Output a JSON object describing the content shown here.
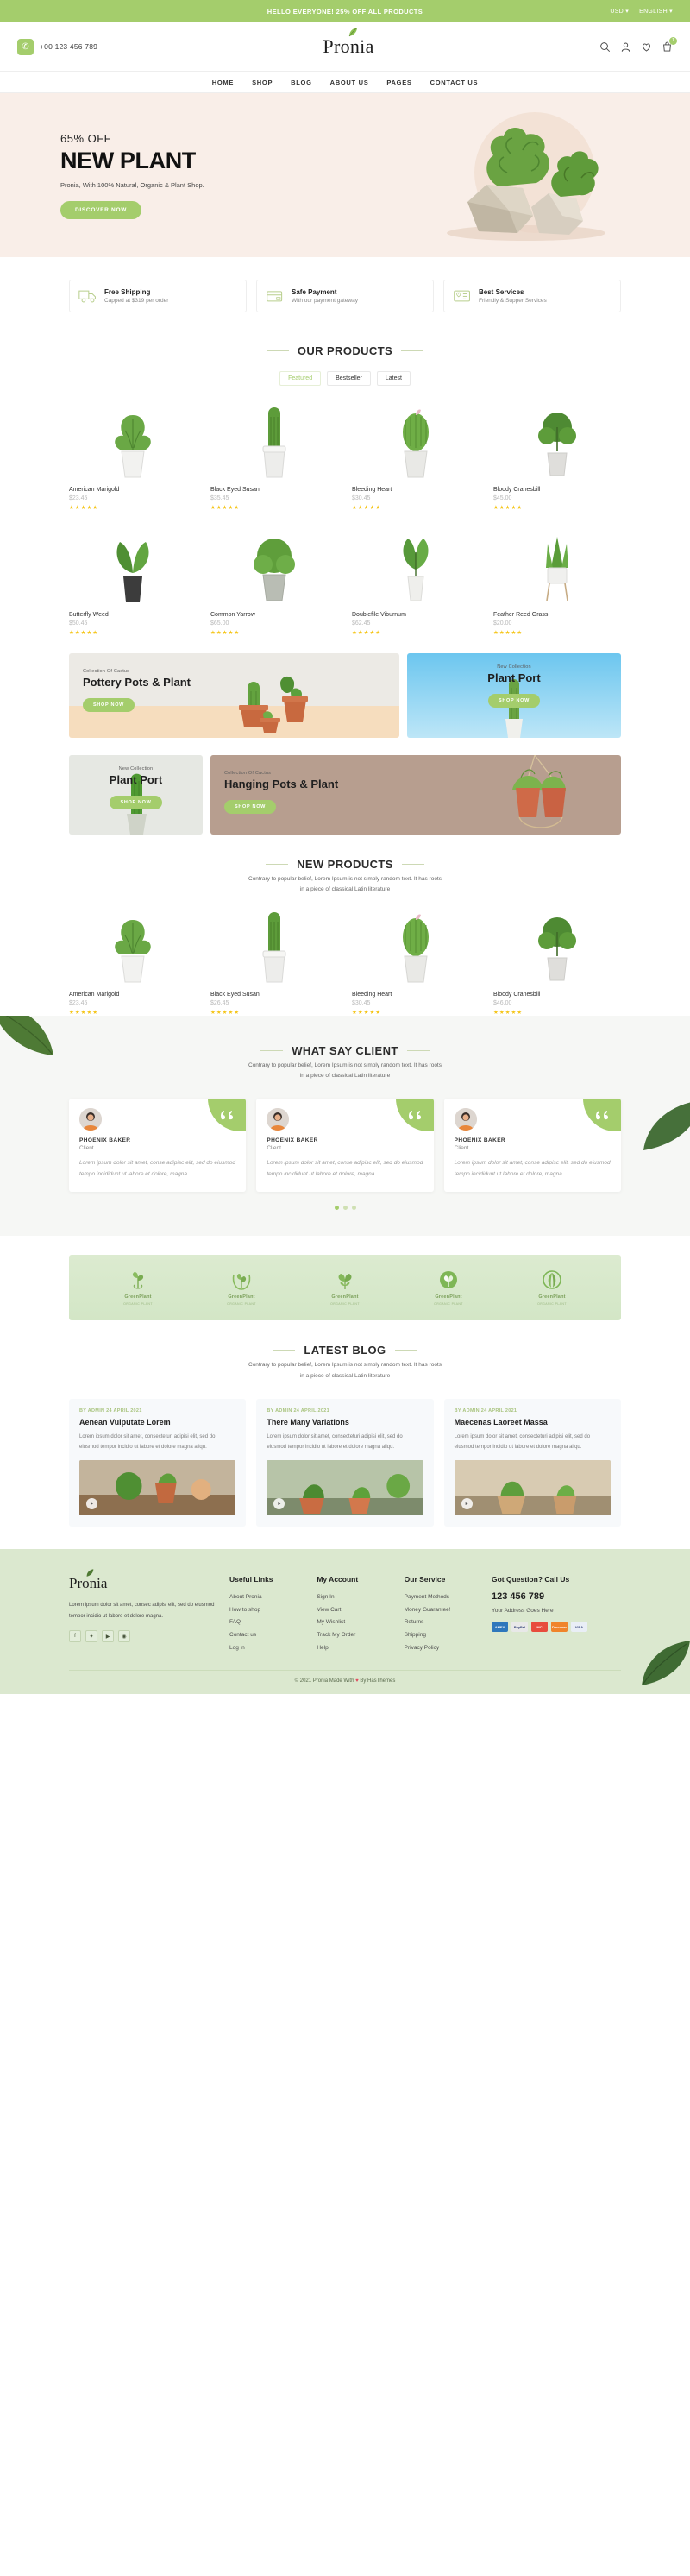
{
  "topbar": {
    "promo": "HELLO EVERYONE! 25% OFF ALL PRODUCTS",
    "currency": "USD",
    "language": "ENGLISH"
  },
  "header": {
    "phone": "+00 123 456 789",
    "logo": "Pronia",
    "icons": [
      "search-icon",
      "user-icon",
      "wishlist-icon",
      "cart-icon"
    ],
    "cart_count": "1"
  },
  "nav": {
    "items": [
      "HOME",
      "SHOP",
      "BLOG",
      "ABOUT US",
      "PAGES",
      "CONTACT US"
    ]
  },
  "hero": {
    "offer": "65% OFF",
    "title": "NEW PLANT",
    "subtitle": "Pronia, With 100% Natural, Organic & Plant Shop.",
    "cta": "DISCOVER NOW"
  },
  "features": [
    {
      "icon": "truck-icon",
      "title": "Free Shipping",
      "subtitle": "Capped at $319 per order"
    },
    {
      "icon": "card-icon",
      "title": "Safe Payment",
      "subtitle": "With our payment gateway"
    },
    {
      "icon": "support-icon",
      "title": "Best Services",
      "subtitle": "Friendly & Supper Services"
    }
  ],
  "products_section": {
    "title": "OUR PRODUCTS",
    "tabs": [
      {
        "label": "Featured",
        "active": true
      },
      {
        "label": "Bestseller",
        "active": false
      },
      {
        "label": "Latest",
        "active": false
      }
    ],
    "items": [
      {
        "name": "American Marigold",
        "price": "$23.45",
        "rating": 5
      },
      {
        "name": "Black Eyed Susan",
        "price": "$35.45",
        "rating": 5
      },
      {
        "name": "Bleeding Heart",
        "price": "$30.45",
        "rating": 5
      },
      {
        "name": "Bloody Cranesbill",
        "price": "$45.00",
        "rating": 5
      },
      {
        "name": "Butterfly Weed",
        "price": "$50.45",
        "rating": 5
      },
      {
        "name": "Common Yarrow",
        "price": "$65.00",
        "rating": 5
      },
      {
        "name": "Doublefile Viburnum",
        "price": "$62.45",
        "rating": 5
      },
      {
        "name": "Feather Reed Grass",
        "price": "$20.00",
        "rating": 5
      }
    ]
  },
  "banners": {
    "b1": {
      "eyebrow": "Collection Of Cactus",
      "title": "Pottery Pots & Plant",
      "cta": "SHOP NOW"
    },
    "b2": {
      "eyebrow": "New Collection",
      "title": "Plant Port",
      "cta": "SHOP NOW"
    },
    "b3": {
      "eyebrow": "New Collection",
      "title": "Plant Port",
      "cta": "SHOP NOW"
    },
    "b4": {
      "eyebrow": "Collection Of Cactus",
      "title": "Hanging Pots & Plant",
      "cta": "SHOP NOW"
    }
  },
  "new_products": {
    "title": "NEW PRODUCTS",
    "desc_line1": "Contrary to popular belief, Lorem Ipsum is not simply random text. It has roots",
    "desc_line2": "in a piece of classical Latin literature",
    "items": [
      {
        "name": "American Marigold",
        "price": "$23.45",
        "rating": 5
      },
      {
        "name": "Black Eyed Susan",
        "price": "$26.45",
        "rating": 5
      },
      {
        "name": "Bleeding Heart",
        "price": "$30.45",
        "rating": 5
      },
      {
        "name": "Bloody Cranesbill",
        "price": "$46.00",
        "rating": 5
      }
    ]
  },
  "testimonials": {
    "title": "WHAT SAY CLIENT",
    "desc_line1": "Contrary to popular belief, Lorem Ipsum is not simply random text. It has roots",
    "desc_line2": "in a piece of classical Latin literature",
    "items": [
      {
        "name": "PHOENIX BAKER",
        "role": "Client",
        "text": "Lorem ipsum dolor sit amet, conse adipisc elit, sed do eiusmod tempo incididunt ut labore et dolore, magna"
      },
      {
        "name": "PHOENIX BAKER",
        "role": "Client",
        "text": "Lorem ipsum dolor sit amet, conse adipisc elit, sed do eiusmod tempo incididunt ut labore et dolore, magna"
      },
      {
        "name": "PHOENIX BAKER",
        "role": "Client",
        "text": "Lorem ipsum dolor sit amet, conse adipisc elit, sed do eiusmod tempo incididunt ut labore et dolore, magna"
      }
    ],
    "dots": 3,
    "active_dot": 0
  },
  "brands": [
    {
      "name": "GreenPlant",
      "sub": "ORGANIC PLANT"
    },
    {
      "name": "GreenPlant",
      "sub": "ORGANIC PLANT"
    },
    {
      "name": "GreenPlant",
      "sub": "ORGANIC PLANT"
    },
    {
      "name": "GreenPlant",
      "sub": "ORGANIC PLANT"
    },
    {
      "name": "GreenPlant",
      "sub": "ORGANIC PLANT"
    }
  ],
  "blog": {
    "title": "LATEST BLOG",
    "desc_line1": "Contrary to popular belief, Lorem Ipsum is not simply random text. It has roots",
    "desc_line2": "in a piece of classical Latin literature",
    "posts": [
      {
        "meta": "BY ADMIN  24 APRIL 2021",
        "title": "Aenean Vulputate Lorem",
        "excerpt": "Lorem ipsum dolor sit amet, consecteturi adipisi elit, sed do eiusmod tempor incidio ut labore et dolore magna aliqu."
      },
      {
        "meta": "BY ADMIN  24 APRIL 2021",
        "title": "There Many Variations",
        "excerpt": "Lorem ipsum dolor sit amet, consecteturi adipisi elit, sed do eiusmod tempor incidio ut labore et dolore magna aliqu."
      },
      {
        "meta": "BY ADMIN  24 APRIL 2021",
        "title": "Maecenas Laoreet Massa",
        "excerpt": "Lorem ipsum dolor sit amet, consecteturi adipisi elit, sed do eiusmod tempor incidio ut labore et dolore magna aliqu."
      }
    ]
  },
  "footer": {
    "logo": "Pronia",
    "desc": "Lorem ipsum dolor sit amet, consec adipisi elit, sed do eiusmod tempor incidio ut labore et dolore magna.",
    "socials": [
      "facebook-icon",
      "twitter-icon",
      "youtube-icon",
      "instagram-icon"
    ],
    "col_useful": {
      "heading": "Useful Links",
      "links": [
        "About Pronia",
        "How to shop",
        "FAQ",
        "Contact us",
        "Log in"
      ]
    },
    "col_account": {
      "heading": "My Account",
      "links": [
        "Sign In",
        "View Cart",
        "My Wishlist",
        "Track My Order",
        "Help"
      ]
    },
    "col_service": {
      "heading": "Our Service",
      "links": [
        "Payment Methods",
        "Money Guarantee!",
        "Returns",
        "Shipping",
        "Privacy Policy"
      ]
    },
    "col_contact": {
      "heading": "Got Question? Call Us",
      "phone": "123 456 789",
      "address": "Your Address Goes Here",
      "payments": [
        {
          "label": "AMEX",
          "color": "#2e77bc"
        },
        {
          "label": "PayPal",
          "color": "#e8e8e8"
        },
        {
          "label": "MC",
          "color": "#e84c3d"
        },
        {
          "label": "Discover",
          "color": "#f0842a"
        },
        {
          "label": "VISA",
          "color": "#e9eef6"
        }
      ]
    },
    "copyright_pre": "© 2021 Pronia Made With",
    "copyright_post": "By HasThemes"
  },
  "colors": {
    "accent": "#a4cd6c",
    "hero_bg": "#f9eee8",
    "footer_bg": "#dbe8cf",
    "star": "#f5c518"
  }
}
